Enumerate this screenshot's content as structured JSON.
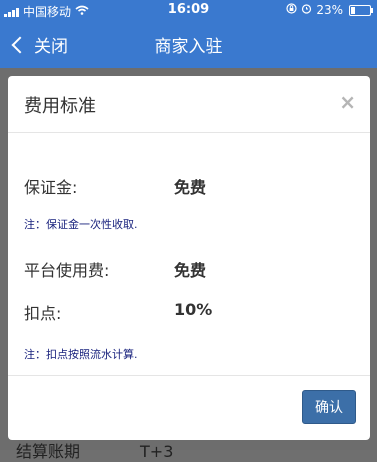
{
  "status_bar": {
    "carrier": "中国移动",
    "time": "16:09",
    "battery": "23%",
    "battery_level": 0.23
  },
  "nav": {
    "back_label": "关闭",
    "title": "商家入驻"
  },
  "modal": {
    "title": "费用标准",
    "close_glyph": "×",
    "rows": [
      {
        "label": "保证金:",
        "value": "免费"
      },
      {
        "label": "平台使用费:",
        "value": "免费"
      },
      {
        "label": "扣点:",
        "value": "10%"
      }
    ],
    "notes": [
      "注：保证金一次性收取.",
      "注：扣点按照流水计算."
    ],
    "confirm_label": "确认"
  },
  "behind": {
    "label": "结算账期",
    "value": "T+3"
  }
}
